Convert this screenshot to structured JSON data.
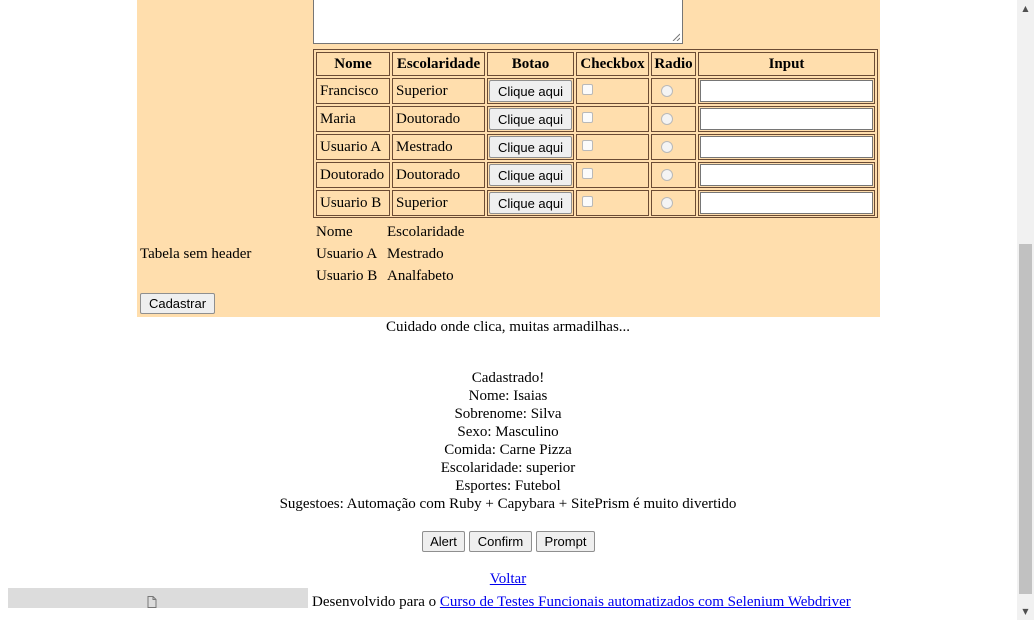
{
  "table": {
    "headers": [
      "Nome",
      "Escolaridade",
      "Botao",
      "Checkbox",
      "Radio",
      "Input"
    ],
    "rows": [
      {
        "nome": "Francisco",
        "escolaridade": "Superior",
        "button": "Clique aqui"
      },
      {
        "nome": "Maria",
        "escolaridade": "Doutorado",
        "button": "Clique aqui"
      },
      {
        "nome": "Usuario A",
        "escolaridade": "Mestrado",
        "button": "Clique aqui"
      },
      {
        "nome": "Doutorado",
        "escolaridade": "Doutorado",
        "button": "Clique aqui"
      },
      {
        "nome": "Usuario B",
        "escolaridade": "Superior",
        "button": "Clique aqui"
      }
    ]
  },
  "plain_table": {
    "label": "Tabela sem header",
    "rows": [
      [
        "Nome",
        "Escolaridade"
      ],
      [
        "Usuario A",
        "Mestrado"
      ],
      [
        "Usuario B",
        "Analfabeto"
      ]
    ]
  },
  "form": {
    "submit_label": "Cadastrar",
    "panel_color": "#ffdead"
  },
  "warning_text": "Cuidado onde clica, muitas armadilhas...",
  "result": {
    "title": "Cadastrado!",
    "lines": [
      "Nome: Isaias",
      "Sobrenome: Silva",
      "Sexo: Masculino",
      "Comida: Carne Pizza",
      "Escolaridade: superior",
      "Esportes: Futebol",
      "Sugestoes: Automação com Ruby + Capybara + SitePrism é muito divertido"
    ]
  },
  "dialog_buttons": {
    "alert": "Alert",
    "confirm": "Confirm",
    "prompt": "Prompt"
  },
  "back_link": "Voltar",
  "footer": {
    "prefix": "Desenvolvido para o ",
    "link_text": "Curso de Testes Funcionais automatizados com Selenium Webdriver"
  },
  "icons": {
    "download": "file-icon"
  }
}
